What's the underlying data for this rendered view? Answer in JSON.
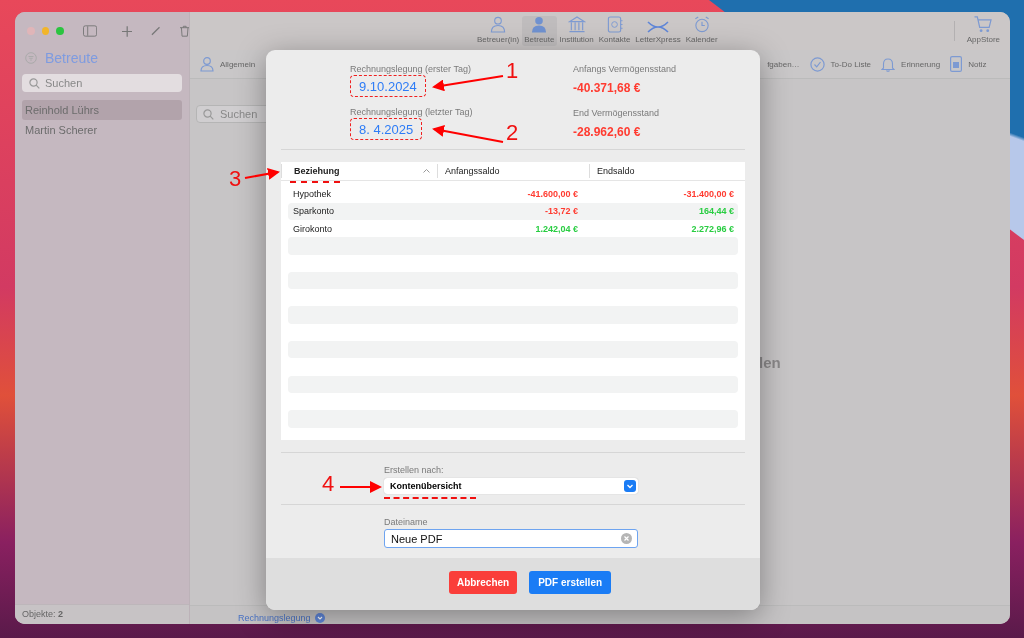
{
  "toolbar": {
    "items": [
      {
        "label": "Betreuer(in)",
        "kind": "caretaker",
        "selected": false
      },
      {
        "label": "Betreute",
        "kind": "person",
        "selected": true
      },
      {
        "label": "Institution",
        "kind": "bank",
        "selected": false
      },
      {
        "label": "Kontakte",
        "kind": "contacts",
        "selected": false
      },
      {
        "label": "LetterXpress",
        "kind": "letter",
        "selected": false
      },
      {
        "label": "Kalender",
        "kind": "clock",
        "selected": false
      }
    ],
    "store": {
      "label": "AppStore"
    }
  },
  "sidebar": {
    "title": "Betreute",
    "search_placeholder": "Suchen",
    "items": [
      {
        "label": "Reinhold Lührs",
        "selected": true
      },
      {
        "label": "Martin Scherer",
        "selected": false
      }
    ],
    "status": "Objekte: **2**"
  },
  "tabs": [
    {
      "label": "Allgemein",
      "kind": "person"
    },
    {
      "label": "fgaben…",
      "kind": "text"
    },
    {
      "label": "To-Do Liste",
      "kind": "check"
    },
    {
      "label": "Erinnerung",
      "kind": "bell"
    },
    {
      "label": "Notiz",
      "kind": "note"
    }
  ],
  "main": {
    "search_placeholder": "Suchen",
    "background_text": "len",
    "footer_link": "Rechnungslegung"
  },
  "dialog": {
    "first_day": {
      "label": "Rechnungslegung (erster Tag)",
      "value": "9.10.2024"
    },
    "last_day": {
      "label": "Rechnungslegung (letzter Tag)",
      "value": "8.  4.2025"
    },
    "start_assets": {
      "label": "Anfangs Vermögensstand",
      "value": "-40.371,68 €",
      "color": "#ff3b30"
    },
    "end_assets": {
      "label": "End Vermögensstand",
      "value": "-28.962,60 €",
      "color": "#ff3b30"
    },
    "table": {
      "columns": [
        "Beziehung",
        "Anfangssaldo",
        "Endsaldo"
      ],
      "rows": [
        {
          "name": "Hypothek",
          "start": {
            "text": "-41.600,00 €",
            "color": "#ff3b30"
          },
          "end": {
            "text": "-31.400,00 €",
            "color": "#ff3b30"
          }
        },
        {
          "name": "Sparkonto",
          "start": {
            "text": "-13,72 €",
            "color": "#ff3b30"
          },
          "end": {
            "text": "164,44 €",
            "color": "#28cd41"
          }
        },
        {
          "name": "Girokonto",
          "start": {
            "text": "1.242,04 €",
            "color": "#28cd41"
          },
          "end": {
            "text": "2.272,96 €",
            "color": "#28cd41"
          }
        }
      ]
    },
    "create_by": {
      "label": "Erstellen nach:",
      "value": "Kontenübersicht"
    },
    "filename": {
      "label": "Dateiname",
      "value": "Neue PDF"
    },
    "buttons": [
      {
        "label": "Abbrechen",
        "kind": "cancel"
      },
      {
        "label": "PDF erstellen",
        "kind": "primary"
      }
    ]
  },
  "annotations": [
    {
      "label": "1"
    },
    {
      "label": "2"
    },
    {
      "label": "3"
    },
    {
      "label": "4"
    }
  ]
}
